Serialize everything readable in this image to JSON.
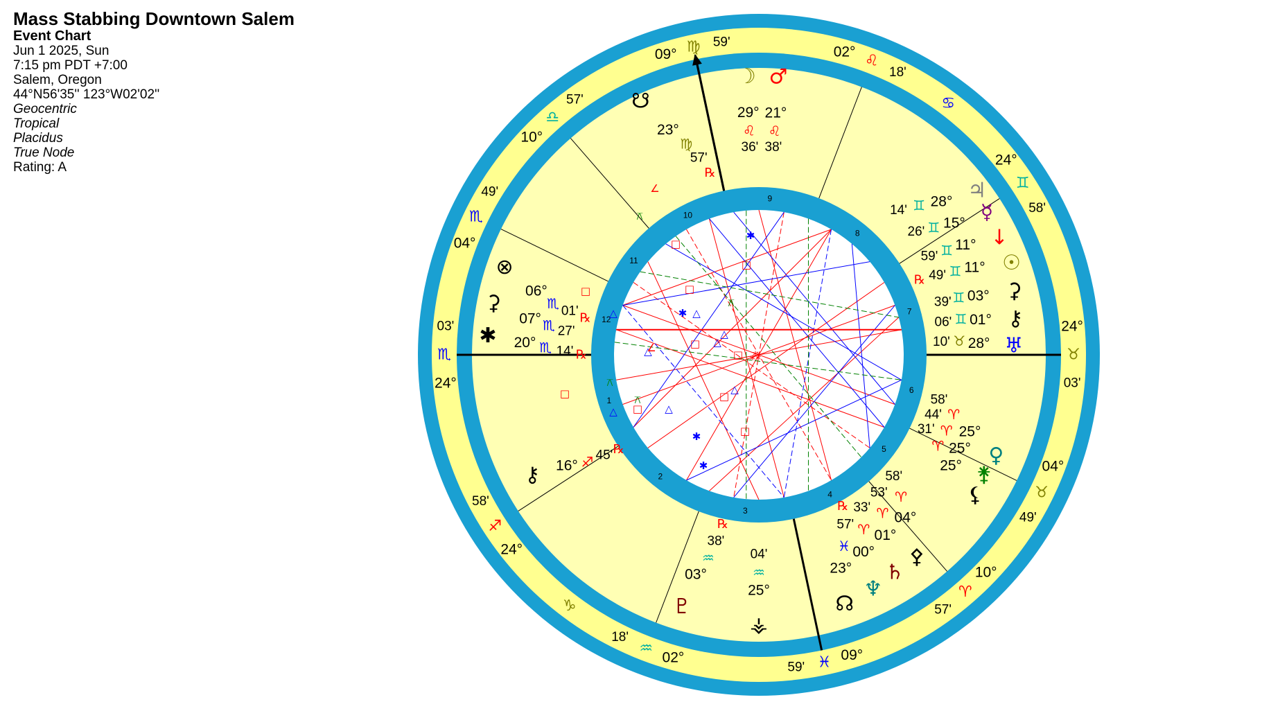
{
  "info": {
    "title": "Mass Stabbing Downtown Salem",
    "chart_type": "Event Chart",
    "date": "Jun 1 2025, Sun",
    "time": "7:15 pm  PDT +7:00",
    "place": "Salem, Oregon",
    "coords": "44°N56'35'' 123°W02'02''",
    "opt1": "Geocentric",
    "opt2": "Tropical",
    "opt3": "Placidus",
    "opt4": "True Node",
    "rating": "Rating: A"
  },
  "colors": {
    "ring_blue": "#1aa0d2",
    "ring_yellow": "#ffff90",
    "house_yellow": "#ffffb4",
    "fire": "#ff0000",
    "earth": "#808000",
    "air": "#00b0a0",
    "water": "#0000ff",
    "aspect_hard": "#ff0000",
    "aspect_soft": "#0000ff",
    "aspect_minor": "#008000"
  },
  "cusps": [
    {
      "deg": "24°",
      "sign": "♏",
      "signColor": "#0000ff",
      "min": "03'"
    },
    {
      "deg": "24°",
      "sign": "♐",
      "signColor": "#ff0000",
      "min": "58'"
    },
    {
      "deg": "02°",
      "sign": "♒",
      "signColor": "#00b0a0",
      "min": "18'"
    },
    {
      "deg": "09°",
      "sign": "♓",
      "signColor": "#0000ff",
      "min": "59'"
    },
    {
      "deg": "10°",
      "sign": "♈",
      "signColor": "#ff0000",
      "min": "57'"
    },
    {
      "deg": "04°",
      "sign": "♉",
      "signColor": "#808000",
      "min": "49'"
    },
    {
      "deg": "24°",
      "sign": "♉",
      "signColor": "#808000",
      "min": "03'"
    },
    {
      "deg": "24°",
      "sign": "♊",
      "signColor": "#00b0a0",
      "min": "58'"
    },
    {
      "deg": "02°",
      "sign": "♌",
      "signColor": "#ff0000",
      "min": "18'"
    },
    {
      "deg": "09°",
      "sign": "♍",
      "signColor": "#808000",
      "min": "59'"
    },
    {
      "deg": "10°",
      "sign": "♎",
      "signColor": "#00b0a0",
      "min": "57'"
    },
    {
      "deg": "04°",
      "sign": "♏",
      "signColor": "#0000ff",
      "min": "49'"
    }
  ],
  "intercepted": [
    {
      "sign": "♋",
      "color": "#0000ff"
    },
    {
      "sign": "♑",
      "color": "#808000"
    }
  ],
  "house_numbers": [
    "1",
    "2",
    "3",
    "4",
    "5",
    "6",
    "7",
    "8",
    "9",
    "10",
    "11",
    "12"
  ],
  "planets": [
    {
      "name": "Moon",
      "glyph": "☽",
      "color": "#808000",
      "deg": "29°",
      "sign": "♌",
      "signColor": "#ff0000",
      "min": "36'",
      "rx": ""
    },
    {
      "name": "Mars",
      "glyph": "♂",
      "color": "#ff0000",
      "deg": "21°",
      "sign": "♌",
      "signColor": "#ff0000",
      "min": "38'",
      "rx": ""
    },
    {
      "name": "South Node",
      "glyph": "☋",
      "color": "#000000",
      "deg": "23°",
      "sign": "♍",
      "signColor": "#808000",
      "min": "57'",
      "rx": "℞"
    },
    {
      "name": "Jupiter",
      "glyph": "♃",
      "color": "#808080",
      "deg": "28°",
      "sign": "♊",
      "signColor": "#00b0a0",
      "min": "14'",
      "rx": ""
    },
    {
      "name": "Mercury",
      "glyph": "☿",
      "color": "#800080",
      "deg": "15°",
      "sign": "♊",
      "signColor": "#00b0a0",
      "min": "26'",
      "rx": ""
    },
    {
      "name": "Vertex",
      "glyph": "↓",
      "color": "#ff0000",
      "deg": "11°",
      "sign": "♊",
      "signColor": "#00b0a0",
      "min": "59'",
      "rx": ""
    },
    {
      "name": "Sun",
      "glyph": "☉",
      "color": "#808000",
      "deg": "11°",
      "sign": "♊",
      "signColor": "#00b0a0",
      "min": "49'",
      "rx": "℞"
    },
    {
      "name": "Ceres",
      "glyph": "⚳",
      "color": "#000000",
      "deg": "03°",
      "sign": "♊",
      "signColor": "#00b0a0",
      "min": "39'",
      "rx": ""
    },
    {
      "name": "Chiron",
      "glyph": "⚷",
      "color": "#000000",
      "deg": "01°",
      "sign": "♊",
      "signColor": "#00b0a0",
      "min": "06'",
      "rx": ""
    },
    {
      "name": "Uranus",
      "glyph": "♅",
      "color": "#0000ff",
      "deg": "28°",
      "sign": "♉",
      "signColor": "#808000",
      "min": "10'",
      "rx": ""
    },
    {
      "name": "Venus",
      "glyph": "♀",
      "color": "#008080",
      "deg": "25°",
      "sign": "♈",
      "signColor": "#ff0000",
      "min": "58'",
      "rx": ""
    },
    {
      "name": "Juno",
      "glyph": "⚵",
      "color": "#008000",
      "deg": "25°",
      "sign": "♈",
      "signColor": "#ff0000",
      "min": "44'",
      "rx": ""
    },
    {
      "name": "Lilith",
      "glyph": "⚸",
      "color": "#000000",
      "deg": "25°",
      "sign": "♈",
      "signColor": "#ff0000",
      "min": "31'",
      "rx": ""
    },
    {
      "name": "Pallas",
      "glyph": "⚴",
      "color": "#000000",
      "deg": "04°",
      "sign": "♈",
      "signColor": "#ff0000",
      "min": "58'",
      "rx": ""
    },
    {
      "name": "Saturn",
      "glyph": "♄",
      "color": "#800000",
      "deg": "01°",
      "sign": "♈",
      "signColor": "#ff0000",
      "min": "53'",
      "rx": ""
    },
    {
      "name": "Neptune",
      "glyph": "♆",
      "color": "#008080",
      "deg": "00°",
      "sign": "♈",
      "signColor": "#ff0000",
      "min": "33'",
      "rx": ""
    },
    {
      "name": "North Node",
      "glyph": "☊",
      "color": "#000000",
      "deg": "23°",
      "sign": "♓",
      "signColor": "#0000ff",
      "min": "57'",
      "rx": "℞"
    },
    {
      "name": "Pluto",
      "glyph": "♇",
      "color": "#800000",
      "deg": "03°",
      "sign": "♒",
      "signColor": "#00b0a0",
      "min": "38'",
      "rx": "℞"
    },
    {
      "name": "Vesta",
      "glyph": "⚶",
      "color": "#000000",
      "deg": "25°",
      "sign": "♒",
      "signColor": "#00b0a0",
      "min": "04'",
      "rx": ""
    },
    {
      "name": "Chiron2",
      "glyph": "⚷",
      "color": "#000000",
      "deg": "16°",
      "sign": "♐",
      "signColor": "#ff0000",
      "min": "45'",
      "rx": "℞"
    },
    {
      "name": "Fortune",
      "glyph": "⊗",
      "color": "#000000",
      "deg": "06°",
      "sign": "♏",
      "signColor": "#0000ff",
      "min": "01'",
      "rx": "℞"
    },
    {
      "name": "Pluto2",
      "glyph": "⚳",
      "color": "#000000",
      "deg": "07°",
      "sign": "♏",
      "signColor": "#0000ff",
      "min": "27'",
      "rx": ""
    },
    {
      "name": "Star",
      "glyph": "✱",
      "color": "#000000",
      "deg": "20°",
      "sign": "♏",
      "signColor": "#0000ff",
      "min": "14'",
      "rx": "℞"
    }
  ]
}
